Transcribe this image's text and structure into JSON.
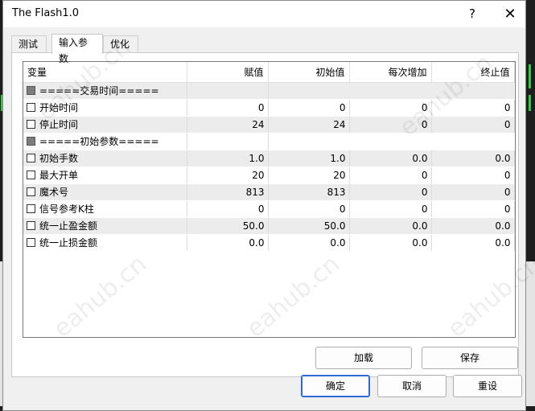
{
  "window": {
    "title": "The Flash1.0",
    "help_label": "?",
    "close_label": "✕"
  },
  "tabs": [
    {
      "label": "测试",
      "active": false
    },
    {
      "label": "输入参数",
      "active": true
    },
    {
      "label": "优化",
      "active": false
    }
  ],
  "table": {
    "columns": [
      "变量",
      "赋值",
      "初始值",
      "每次增加",
      "终止值"
    ],
    "rows": [
      {
        "kind": "header",
        "name": "=====交易时间=====",
        "value": "",
        "start": "",
        "step": "",
        "stop": ""
      },
      {
        "kind": "param",
        "name": "开始时间",
        "value": "0",
        "start": "0",
        "step": "0",
        "stop": "0"
      },
      {
        "kind": "param",
        "name": "停止时间",
        "value": "24",
        "start": "24",
        "step": "0",
        "stop": "0"
      },
      {
        "kind": "header",
        "name": "=====初始参数=====",
        "value": "",
        "start": "",
        "step": "",
        "stop": ""
      },
      {
        "kind": "param",
        "name": "初始手数",
        "value": "1.0",
        "start": "1.0",
        "step": "0.0",
        "stop": "0.0"
      },
      {
        "kind": "param",
        "name": "最大开单",
        "value": "20",
        "start": "20",
        "step": "0",
        "stop": "0"
      },
      {
        "kind": "param",
        "name": "魔术号",
        "value": "813",
        "start": "813",
        "step": "0",
        "stop": "0"
      },
      {
        "kind": "param",
        "name": "信号参考K柱",
        "value": "0",
        "start": "0",
        "step": "0",
        "stop": "0"
      },
      {
        "kind": "param",
        "name": "统一止盈金额",
        "value": "50.0",
        "start": "50.0",
        "step": "0.0",
        "stop": "0.0"
      },
      {
        "kind": "param",
        "name": "统一止损金额",
        "value": "0.0",
        "start": "0.0",
        "step": "0.0",
        "stop": "0.0"
      }
    ]
  },
  "buttons": {
    "load": "加载",
    "save": "保存",
    "ok": "确定",
    "cancel": "取消",
    "reset": "重设"
  },
  "watermark": "eahub.cn",
  "colors": {
    "primary_border": "#2b6bd6",
    "row_alt": "#ececec",
    "dialog_bg": "#f0f0f0"
  }
}
